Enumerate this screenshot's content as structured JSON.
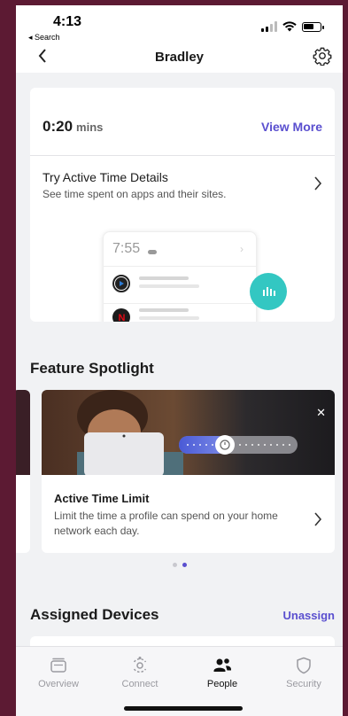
{
  "status_bar": {
    "time": "4:13",
    "back_app": "◂ Search"
  },
  "header": {
    "title": "Bradley"
  },
  "active_time": {
    "value": "0:20",
    "unit": "mins",
    "view_more": "View More",
    "try_title": "Try Active Time Details",
    "try_subtitle": "See time spent on apps and their sites.",
    "mock_time": "7:55"
  },
  "spotlight": {
    "section_title": "Feature Spotlight",
    "card_title": "Active Time Limit",
    "card_desc": "Limit the time a profile can spend on your home network each day.",
    "pages": 2,
    "active_page": 2
  },
  "devices": {
    "section_title": "Assigned Devices",
    "unassign": "Unassign"
  },
  "tabs": [
    {
      "label": "Overview",
      "icon": "overview-icon",
      "active": false
    },
    {
      "label": "Connect",
      "icon": "connect-icon",
      "active": false
    },
    {
      "label": "People",
      "icon": "people-icon",
      "active": true
    },
    {
      "label": "Security",
      "icon": "shield-icon",
      "active": false
    }
  ],
  "colors": {
    "accent": "#5a4fcf",
    "teal": "#33c7c2",
    "frame": "#5c1a33"
  }
}
